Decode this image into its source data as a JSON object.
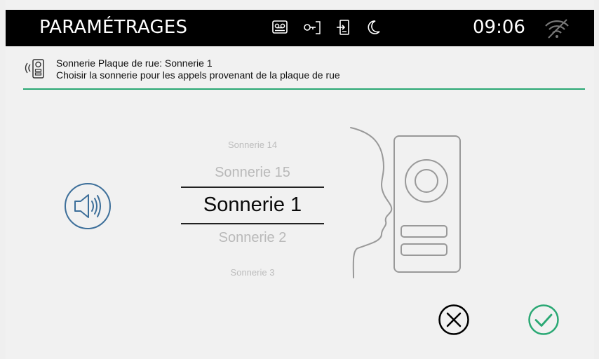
{
  "header": {
    "title": "PARAMÉTRAGES",
    "time": "09:06",
    "status_icons": [
      "voicemail-icon",
      "door-key-icon",
      "door-exit-icon",
      "night-mode-icon",
      "wifi-off-icon"
    ]
  },
  "info": {
    "icon": "door-panel-ringing-icon",
    "line1": "Sonnerie Plaque de rue: Sonnerie 1",
    "line2": "Choisir la sonnerie pour les appels provenant de la plaque de rue"
  },
  "picker": {
    "options": [
      "Sonnerie 14",
      "Sonnerie 15",
      "Sonnerie 1",
      "Sonnerie 2",
      "Sonnerie 3"
    ],
    "selected": "Sonnerie 1"
  },
  "buttons": {
    "play": "speaker-icon",
    "cancel": "cancel-icon",
    "confirm": "check-icon"
  },
  "colors": {
    "accent": "#2aa874",
    "header_bg": "#000000",
    "background": "#f1f1f1",
    "icon_blue": "#3d6f9a"
  }
}
